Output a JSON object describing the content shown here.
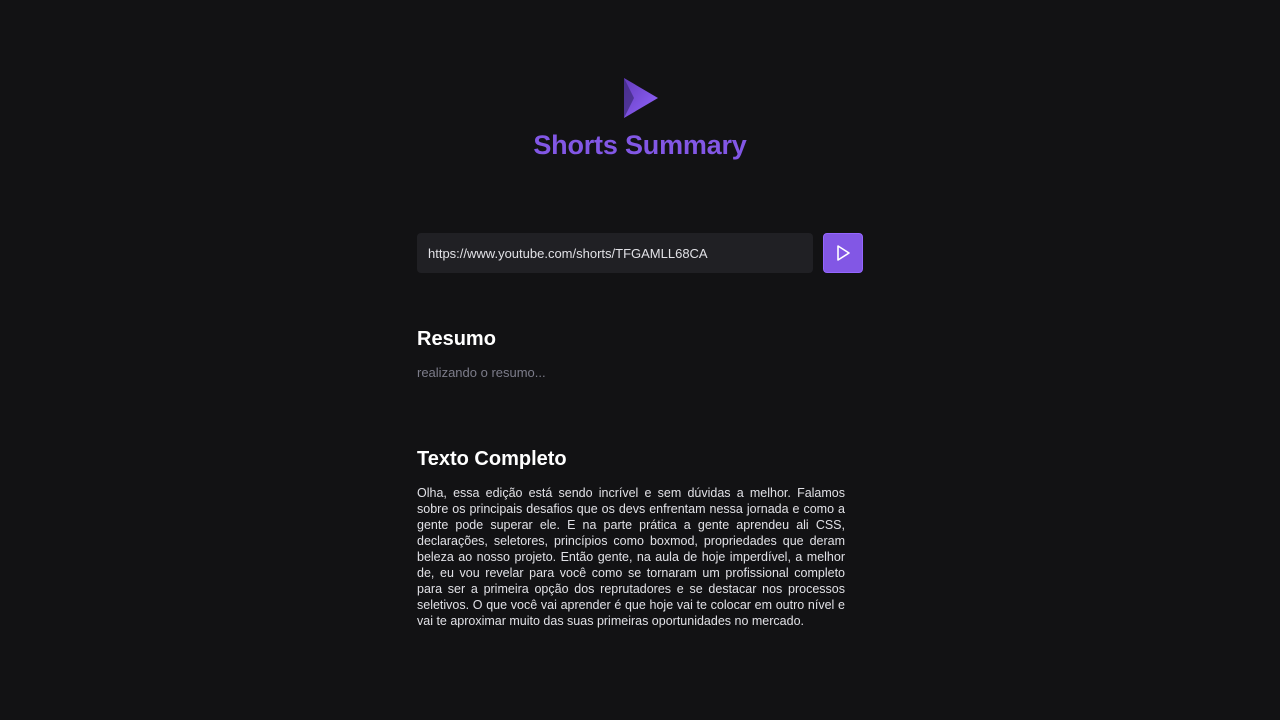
{
  "header": {
    "logo_icon": "play-triangle-icon",
    "title": "Shorts Summary"
  },
  "form": {
    "url_value": "https://www.youtube.com/shorts/TFGAMLL68CA",
    "submit_icon": "play-icon"
  },
  "summary": {
    "heading": "Resumo",
    "status": "realizando o resumo..."
  },
  "full_text": {
    "heading": "Texto Completo",
    "content": "Olha, essa edição está sendo incrível e sem dúvidas a melhor. Falamos sobre os principais desafios que os devs enfrentam nessa jornada e como a gente pode superar ele. E na parte prática a gente aprendeu ali CSS, declarações, seletores, princípios como boxmod, propriedades que deram beleza ao nosso projeto. Então gente, na aula de hoje imperdível, a melhor de, eu vou revelar para você como se tornaram um profissional completo para ser a primeira opção dos reprutadores e se destacar nos processos seletivos. O que você vai aprender é que hoje vai te colocar em outro nível e vai te aproximar muito das suas primeiras oportunidades no mercado."
  },
  "colors": {
    "background": "#121214",
    "accent": "#8257e5",
    "input_bg": "#202024",
    "muted_text": "#7c7c8a"
  }
}
